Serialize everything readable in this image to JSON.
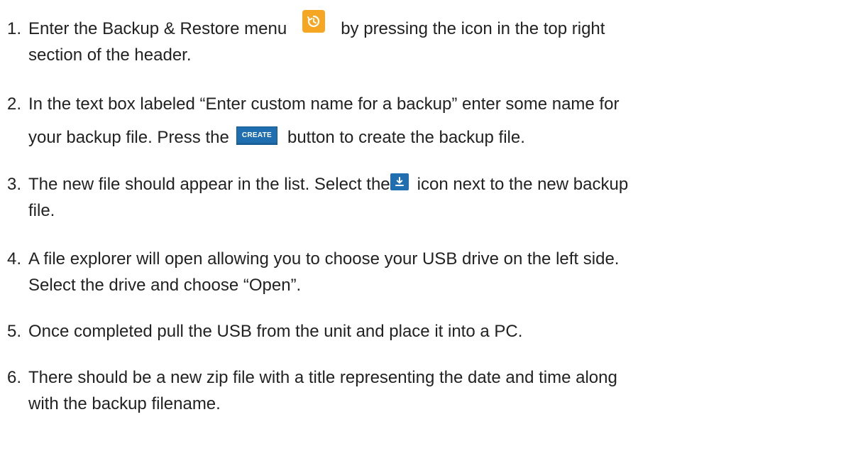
{
  "steps": [
    {
      "number": "1.",
      "line1_before": "Enter the Backup & Restore menu",
      "line1_after": "by pressing the icon in the top right",
      "line2": "section of the header.",
      "icon": "restore-history-icon",
      "icon_color": "#f5a623"
    },
    {
      "number": "2.",
      "line1": "In the text box labeled “Enter custom name for a backup” enter some name for",
      "line2_before": "your backup file. Press the",
      "button_label": "CREATE",
      "line2_after": "button to create the backup file.",
      "button_color": "#1f6fb0"
    },
    {
      "number": "3.",
      "line1_before": "The new file should appear in the list. Select the",
      "line1_after": "icon next to the new backup",
      "line2": "file.",
      "icon": "download-icon",
      "icon_color": "#1f6fb0"
    },
    {
      "number": "4.",
      "line1": "A file explorer will open allowing you to choose your USB drive on the left side.",
      "line2": "Select the drive and choose “Open”."
    },
    {
      "number": "5.",
      "line1": "Once completed pull the USB from the unit and place it into a PC."
    },
    {
      "number": "6.",
      "line1": "There should be a new zip file with a title representing the date and time along",
      "line2": "with the backup filename."
    }
  ]
}
